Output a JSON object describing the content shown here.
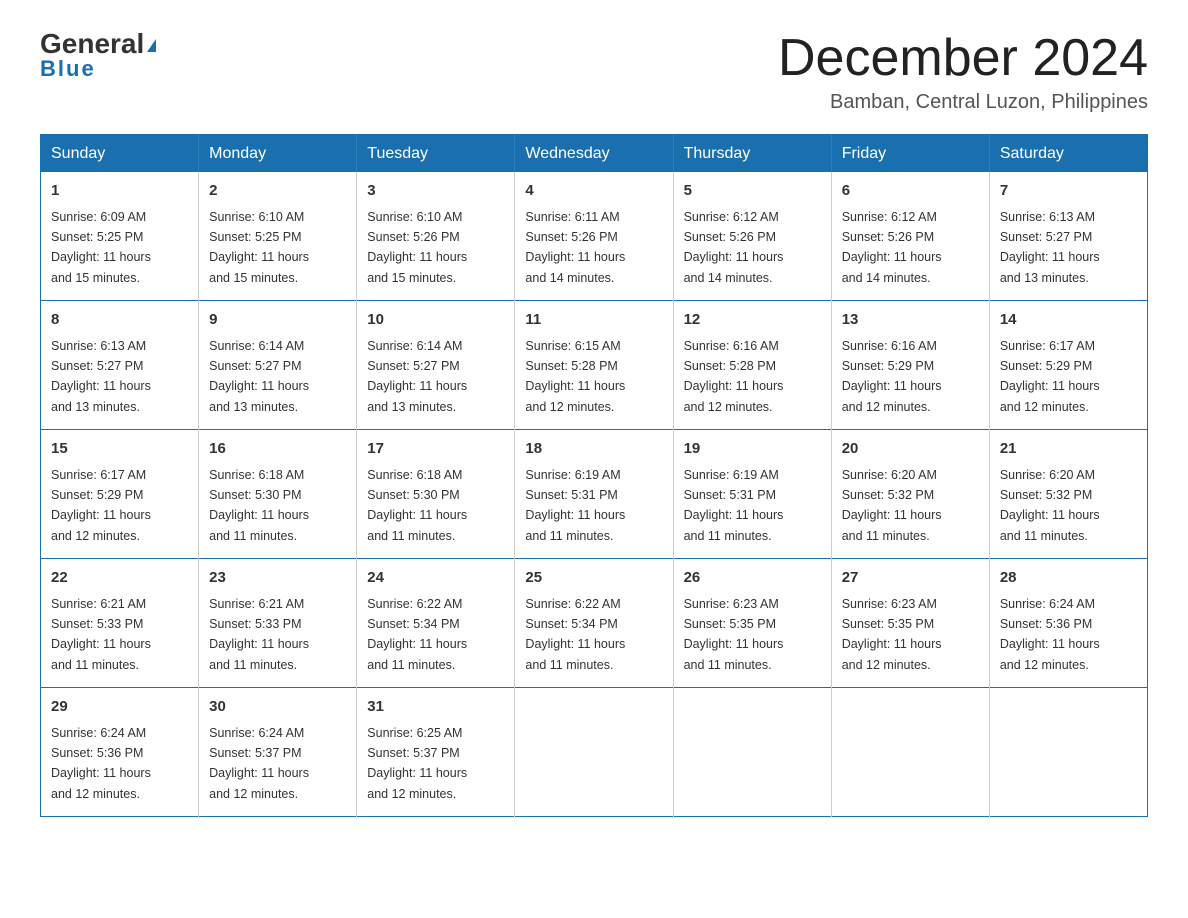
{
  "header": {
    "logo_general": "General",
    "logo_blue": "Blue",
    "month_title": "December 2024",
    "location": "Bamban, Central Luzon, Philippines"
  },
  "weekdays": [
    "Sunday",
    "Monday",
    "Tuesday",
    "Wednesday",
    "Thursday",
    "Friday",
    "Saturday"
  ],
  "weeks": [
    [
      {
        "day": "1",
        "sunrise": "6:09 AM",
        "sunset": "5:25 PM",
        "daylight": "11 hours and 15 minutes."
      },
      {
        "day": "2",
        "sunrise": "6:10 AM",
        "sunset": "5:25 PM",
        "daylight": "11 hours and 15 minutes."
      },
      {
        "day": "3",
        "sunrise": "6:10 AM",
        "sunset": "5:26 PM",
        "daylight": "11 hours and 15 minutes."
      },
      {
        "day": "4",
        "sunrise": "6:11 AM",
        "sunset": "5:26 PM",
        "daylight": "11 hours and 14 minutes."
      },
      {
        "day": "5",
        "sunrise": "6:12 AM",
        "sunset": "5:26 PM",
        "daylight": "11 hours and 14 minutes."
      },
      {
        "day": "6",
        "sunrise": "6:12 AM",
        "sunset": "5:26 PM",
        "daylight": "11 hours and 14 minutes."
      },
      {
        "day": "7",
        "sunrise": "6:13 AM",
        "sunset": "5:27 PM",
        "daylight": "11 hours and 13 minutes."
      }
    ],
    [
      {
        "day": "8",
        "sunrise": "6:13 AM",
        "sunset": "5:27 PM",
        "daylight": "11 hours and 13 minutes."
      },
      {
        "day": "9",
        "sunrise": "6:14 AM",
        "sunset": "5:27 PM",
        "daylight": "11 hours and 13 minutes."
      },
      {
        "day": "10",
        "sunrise": "6:14 AM",
        "sunset": "5:27 PM",
        "daylight": "11 hours and 13 minutes."
      },
      {
        "day": "11",
        "sunrise": "6:15 AM",
        "sunset": "5:28 PM",
        "daylight": "11 hours and 12 minutes."
      },
      {
        "day": "12",
        "sunrise": "6:16 AM",
        "sunset": "5:28 PM",
        "daylight": "11 hours and 12 minutes."
      },
      {
        "day": "13",
        "sunrise": "6:16 AM",
        "sunset": "5:29 PM",
        "daylight": "11 hours and 12 minutes."
      },
      {
        "day": "14",
        "sunrise": "6:17 AM",
        "sunset": "5:29 PM",
        "daylight": "11 hours and 12 minutes."
      }
    ],
    [
      {
        "day": "15",
        "sunrise": "6:17 AM",
        "sunset": "5:29 PM",
        "daylight": "11 hours and 12 minutes."
      },
      {
        "day": "16",
        "sunrise": "6:18 AM",
        "sunset": "5:30 PM",
        "daylight": "11 hours and 11 minutes."
      },
      {
        "day": "17",
        "sunrise": "6:18 AM",
        "sunset": "5:30 PM",
        "daylight": "11 hours and 11 minutes."
      },
      {
        "day": "18",
        "sunrise": "6:19 AM",
        "sunset": "5:31 PM",
        "daylight": "11 hours and 11 minutes."
      },
      {
        "day": "19",
        "sunrise": "6:19 AM",
        "sunset": "5:31 PM",
        "daylight": "11 hours and 11 minutes."
      },
      {
        "day": "20",
        "sunrise": "6:20 AM",
        "sunset": "5:32 PM",
        "daylight": "11 hours and 11 minutes."
      },
      {
        "day": "21",
        "sunrise": "6:20 AM",
        "sunset": "5:32 PM",
        "daylight": "11 hours and 11 minutes."
      }
    ],
    [
      {
        "day": "22",
        "sunrise": "6:21 AM",
        "sunset": "5:33 PM",
        "daylight": "11 hours and 11 minutes."
      },
      {
        "day": "23",
        "sunrise": "6:21 AM",
        "sunset": "5:33 PM",
        "daylight": "11 hours and 11 minutes."
      },
      {
        "day": "24",
        "sunrise": "6:22 AM",
        "sunset": "5:34 PM",
        "daylight": "11 hours and 11 minutes."
      },
      {
        "day": "25",
        "sunrise": "6:22 AM",
        "sunset": "5:34 PM",
        "daylight": "11 hours and 11 minutes."
      },
      {
        "day": "26",
        "sunrise": "6:23 AM",
        "sunset": "5:35 PM",
        "daylight": "11 hours and 11 minutes."
      },
      {
        "day": "27",
        "sunrise": "6:23 AM",
        "sunset": "5:35 PM",
        "daylight": "11 hours and 12 minutes."
      },
      {
        "day": "28",
        "sunrise": "6:24 AM",
        "sunset": "5:36 PM",
        "daylight": "11 hours and 12 minutes."
      }
    ],
    [
      {
        "day": "29",
        "sunrise": "6:24 AM",
        "sunset": "5:36 PM",
        "daylight": "11 hours and 12 minutes."
      },
      {
        "day": "30",
        "sunrise": "6:24 AM",
        "sunset": "5:37 PM",
        "daylight": "11 hours and 12 minutes."
      },
      {
        "day": "31",
        "sunrise": "6:25 AM",
        "sunset": "5:37 PM",
        "daylight": "11 hours and 12 minutes."
      },
      null,
      null,
      null,
      null
    ]
  ],
  "labels": {
    "sunrise": "Sunrise:",
    "sunset": "Sunset:",
    "daylight": "Daylight:"
  }
}
